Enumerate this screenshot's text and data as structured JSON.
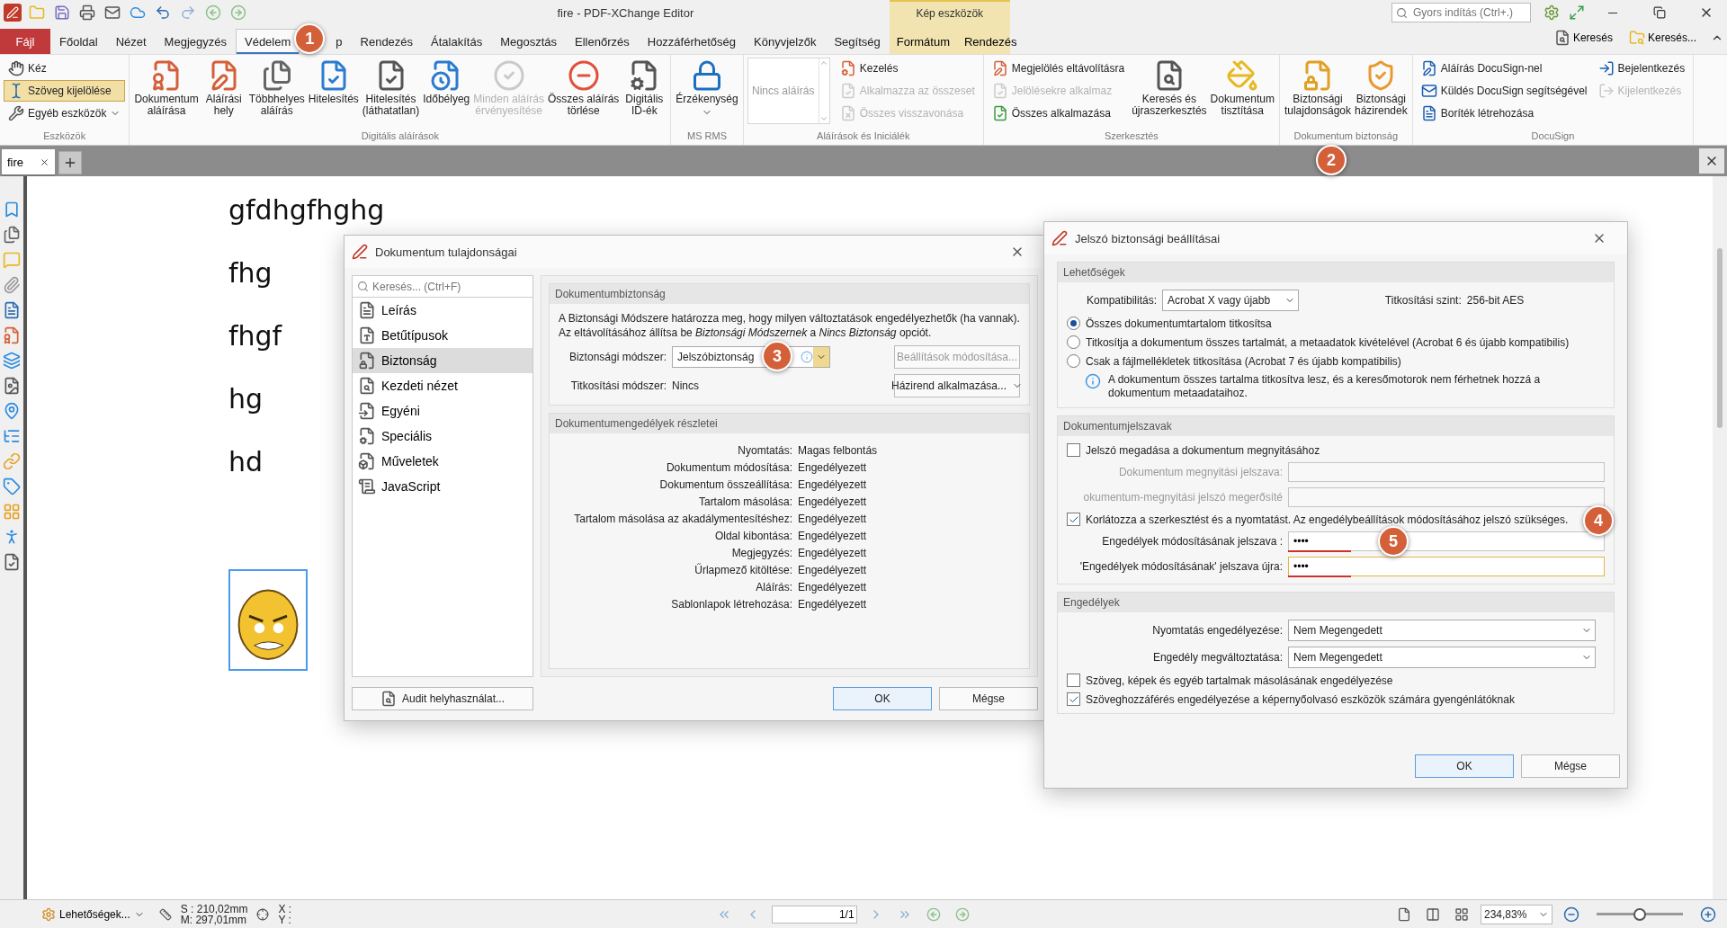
{
  "app": {
    "title": "fire - PDF-XChange Editor",
    "quick_search": {
      "placeholder": "Gyors indítás (Ctrl+.)"
    }
  },
  "menu_tabs": [
    {
      "label": "Fájl",
      "kind": "file",
      "selected": false
    },
    {
      "label": "Főoldal",
      "kind": "tab",
      "selected": false
    },
    {
      "label": "Nézet",
      "kind": "tab",
      "selected": false
    },
    {
      "label": "Megjegyzés",
      "kind": "tab",
      "selected": false
    },
    {
      "label": "Védelem",
      "kind": "tab",
      "selected": true
    },
    {
      "label": "p",
      "kind": "tab",
      "selected": false,
      "callout": "1"
    },
    {
      "label": "Rendezés",
      "kind": "tab",
      "selected": false
    },
    {
      "label": "Átalakítás",
      "kind": "tab",
      "selected": false
    },
    {
      "label": "Megosztás",
      "kind": "tab",
      "selected": false
    },
    {
      "label": "Ellenőrzés",
      "kind": "tab",
      "selected": false
    },
    {
      "label": "Hozzáférhetőség",
      "kind": "tab",
      "selected": false
    },
    {
      "label": "Könyvjelzők",
      "kind": "tab",
      "selected": false
    },
    {
      "label": "Segítség",
      "kind": "tab",
      "selected": false
    }
  ],
  "context_tabs": {
    "label": "Kép eszközök",
    "tabs": [
      {
        "label": "Formátum",
        "selected": false
      },
      {
        "label": "Rendezés",
        "selected": false
      }
    ]
  },
  "quick_finds": [
    "Keresés",
    "Keresés..."
  ],
  "ribbon": [
    {
      "label": "Eszközök",
      "items": [
        {
          "label": "Kéz",
          "kind": "small",
          "disabled": false,
          "selected": false
        },
        {
          "label": "Szöveg kijelölése",
          "kind": "small",
          "disabled": false,
          "selected": true
        },
        {
          "label": "Egyéb eszközök",
          "kind": "small-menu",
          "disabled": false,
          "selected": false
        }
      ]
    },
    {
      "label": "Digitális aláírások",
      "items": [
        {
          "label": "Dokumentum\naláírása",
          "kind": "large",
          "disabled": false
        },
        {
          "label": "Aláírási\nhely",
          "kind": "large",
          "disabled": false
        },
        {
          "label": "Többhelyes\naláírás",
          "kind": "large",
          "disabled": false
        },
        {
          "label": "Hitelesítés",
          "kind": "large",
          "disabled": false
        },
        {
          "label": "Hitelesítés\n(láthatatlan)",
          "kind": "large",
          "disabled": false
        },
        {
          "label": "Időbélyeg",
          "kind": "large",
          "disabled": false
        },
        {
          "label": "Minden aláírás\nérvényesítése",
          "kind": "large",
          "disabled": true
        },
        {
          "label": "Összes aláírás\ntörlése",
          "kind": "large",
          "disabled": false
        },
        {
          "label": "Digitális\nID-ék",
          "kind": "large",
          "disabled": false
        }
      ]
    },
    {
      "label": "MS RMS",
      "items": [
        {
          "label": "Érzékenység",
          "kind": "large-menu",
          "disabled": false
        }
      ]
    },
    {
      "label": "Aláírások és Iniciálék",
      "items": [
        {
          "label": "Nincs aláírás",
          "kind": "gallery",
          "disabled": false
        },
        {
          "label": "Kezelés",
          "kind": "small",
          "disabled": false
        },
        {
          "label": "Alkalmazza az összeset",
          "kind": "small",
          "disabled": true
        },
        {
          "label": "Összes visszavonása",
          "kind": "small",
          "disabled": true
        }
      ]
    },
    {
      "label": "Szerkesztés",
      "items": [
        {
          "label": "Megjelölés eltávolításra",
          "kind": "small",
          "disabled": false
        },
        {
          "label": "Jelölésekre alkalmaz",
          "kind": "small",
          "disabled": true
        },
        {
          "label": "Összes alkalmazása",
          "kind": "small",
          "disabled": false
        },
        {
          "label": "Keresés és\nújraszerkesztés",
          "kind": "large",
          "disabled": false
        },
        {
          "label": "Dokumentum\ntisztítása",
          "kind": "large",
          "disabled": false
        }
      ]
    },
    {
      "label": "Dokumentum biztonság",
      "callout": "2",
      "items": [
        {
          "label": "Biztonsági\ntulajdonságok",
          "kind": "large",
          "disabled": false
        },
        {
          "label": "Biztonsági\nházirendek",
          "kind": "large",
          "disabled": false
        }
      ]
    },
    {
      "label": "DocuSign",
      "items": [
        {
          "label": "Aláírás DocuSign-nel",
          "kind": "small",
          "disabled": false
        },
        {
          "label": "Küldés DocuSign segítségével",
          "kind": "small",
          "disabled": false
        },
        {
          "label": "Boríték létrehozása",
          "kind": "small",
          "disabled": false
        },
        {
          "label": "Bejelentkezés",
          "kind": "small",
          "disabled": false
        },
        {
          "label": "Kijelentkezés",
          "kind": "small",
          "disabled": true
        }
      ]
    }
  ],
  "document_tabs": [
    {
      "label": "fire",
      "selected": true
    }
  ],
  "document": {
    "lines": [
      "gfdhgfhghg",
      "fhg",
      "fhgf",
      "hg",
      "hd"
    ]
  },
  "status_bar": {
    "options": "Lehetőségek...",
    "width": "S : 210,02mm",
    "height": "M: 297,01mm",
    "x": "X :",
    "y": "Y :",
    "page": "1/1",
    "zoom": "234,83%",
    "zoom_level": {
      "level": 0.5
    }
  },
  "properties_dialog": {
    "title": "Dokumentum tulajdonságai",
    "search": {
      "placeholder": "Keresés... (Ctrl+F)"
    },
    "categories": [
      {
        "label": "Leírás",
        "selected": false
      },
      {
        "label": "Betűtípusok",
        "selected": false
      },
      {
        "label": "Biztonság",
        "selected": true
      },
      {
        "label": "Kezdeti nézet",
        "selected": false
      },
      {
        "label": "Egyéni",
        "selected": false
      },
      {
        "label": "Speciális",
        "selected": false
      },
      {
        "label": "Műveletek",
        "selected": false
      },
      {
        "label": "JavaScript",
        "selected": false
      }
    ],
    "security": {
      "heading": "Dokumentumbiztonság",
      "text": "A Biztonsági Módszere határozza meg, hogy milyen változtatások engedélyezhetők (ha vannak). Az eltávolításához állítsa be *Biztonsági Módszernek* a *Nincs Biztonság* opciót.",
      "method_label": "Biztonsági módszer:",
      "method_value": "Jelszóbiztonság",
      "method_callout": "3",
      "change_button": {
        "label": "Beállítások módosítása...",
        "disabled": true
      },
      "encryption_label": "Titkosítási módszer:",
      "encryption_value": "Nincs",
      "policy_button": "Házirend alkalmazása..."
    },
    "permissions": {
      "heading": "Dokumentumengedélyek részletei",
      "rows": [
        {
          "label": "Nyomtatás:",
          "value": "Magas felbontás"
        },
        {
          "label": "Dokumentum módosítása:",
          "value": "Engedélyezett"
        },
        {
          "label": "Dokumentum összeállítása:",
          "value": "Engedélyezett"
        },
        {
          "label": "Tartalom másolása:",
          "value": "Engedélyezett"
        },
        {
          "label": "Tartalom másolása az akadálymentesítéshez:",
          "value": "Engedélyezett"
        },
        {
          "label": "Oldal kibontása:",
          "value": "Engedélyezett"
        },
        {
          "label": "Megjegyzés:",
          "value": "Engedélyezett"
        },
        {
          "label": "Űrlapmező kitöltése:",
          "value": "Engedélyezett"
        },
        {
          "label": "Aláírás:",
          "value": "Engedélyezett"
        },
        {
          "label": "Sablonlapok létrehozása:",
          "value": "Engedélyezett"
        }
      ]
    },
    "audit_button": "Audit helyhasználat...",
    "buttons": [
      {
        "label": "OK",
        "kind": "default"
      },
      {
        "label": "Mégse",
        "kind": "normal"
      }
    ]
  },
  "password_dialog": {
    "title": "Jelszó biztonsági beállításai",
    "options": {
      "heading": "Lehetőségek",
      "compatibility_label": "Kompatibilitás:",
      "compatibility_value": "Acrobat X vagy újabb",
      "level_label": "Titkosítási szint:",
      "level_value": "256-bit AES",
      "radios": [
        {
          "label": "Összes dokumentumtartalom titkosítsa",
          "selected": true
        },
        {
          "label": "Titkosítja a dokumentum összes tartalmát, a metaadatok kivételével (Acrobat 6 és újabb kompatibilis)",
          "selected": false
        },
        {
          "label": "Csak a fájlmellékletek titkosítása (Acrobat 7 és újabb kompatibilis)",
          "selected": false
        }
      ],
      "note": "A dokumentum összes tartalma titkosítva lesz, és a keresőmotorok nem férhetnek hozzá a dokumentum metaadataihoz."
    },
    "passwords": {
      "heading": "Dokumentumjelszavak",
      "open_check": {
        "label": "Jelszó megadása a dokumentum megnyitásához",
        "checked": false
      },
      "open_fields": [
        {
          "label": "Dokumentum megnyitási jelszava:",
          "disabled": true
        },
        {
          "label": "okumentum-megnyitási jelszó megerősíté",
          "disabled": true
        }
      ],
      "restrict_check": {
        "label": "Korlátozza a szerkesztést és a nyomtatást. Az engedélybeállítások módosításához jelszó szükséges.",
        "checked": true,
        "callout": "4"
      },
      "permission_fields": [
        {
          "label": "Engedélyek módosításának jelszava :",
          "value": "••••",
          "level": 0.2,
          "focused": false,
          "callout": "5"
        },
        {
          "label": "'Engedélyek módosításának' jelszava újra:",
          "value": "••••",
          "level": 0.2,
          "focused": true
        }
      ]
    },
    "permissions": {
      "heading": "Engedélyek",
      "selects": [
        {
          "label": "Nyomtatás engedélyezése:",
          "value": "Nem Megengedett"
        },
        {
          "label": "Engedély megváltoztatása:",
          "value": "Nem Megengedett"
        }
      ],
      "checks": [
        {
          "label": "Szöveg, képek és egyéb tartalmak másolásának engedélyezése",
          "checked": false
        },
        {
          "label": "Szöveghozzáférés engedélyezése a képernyőolvasó eszközök számára gyengénlátóknak",
          "checked": true
        }
      ]
    },
    "buttons": [
      {
        "label": "OK",
        "kind": "default"
      },
      {
        "label": "Mégse",
        "kind": "normal"
      }
    ]
  }
}
